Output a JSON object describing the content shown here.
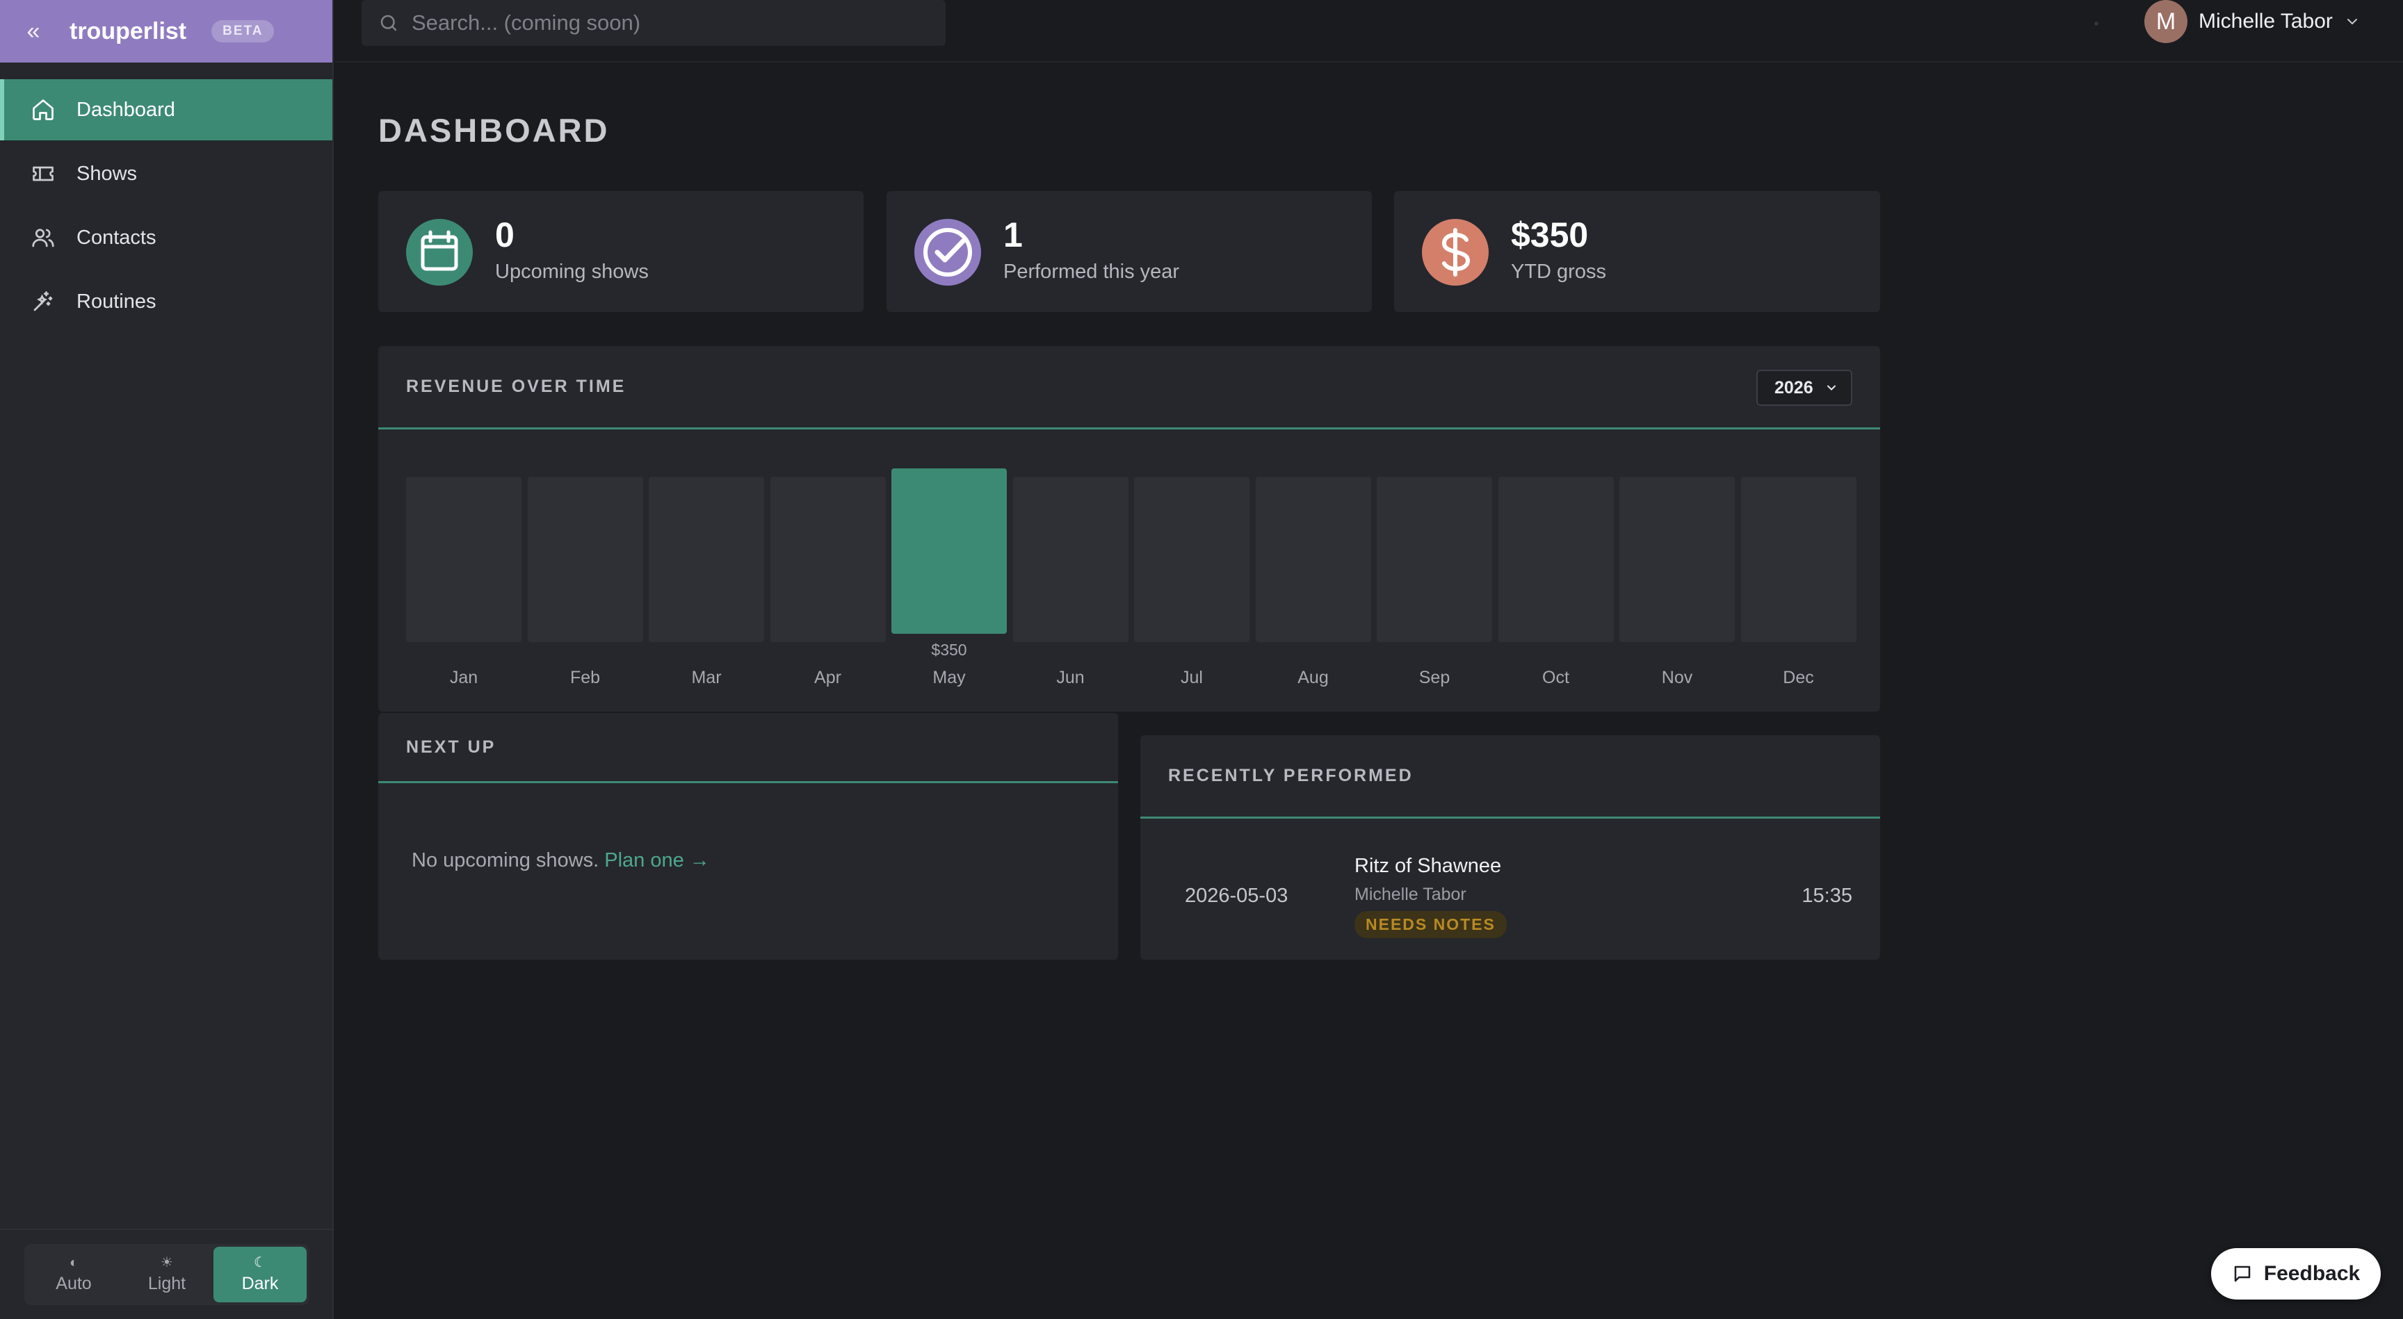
{
  "app": {
    "name": "trouperlist",
    "badge": "BETA",
    "collapse_icon": "«"
  },
  "sidebar": {
    "items": [
      {
        "label": "Dashboard",
        "icon": "home-icon",
        "active": true
      },
      {
        "label": "Shows",
        "icon": "ticket-icon",
        "active": false
      },
      {
        "label": "Contacts",
        "icon": "users-icon",
        "active": false
      },
      {
        "label": "Routines",
        "icon": "sparkle-wand-icon",
        "active": false
      }
    ],
    "theme": [
      {
        "label": "Auto",
        "icon": "◐",
        "active": false
      },
      {
        "label": "Light",
        "icon": "☀",
        "active": false
      },
      {
        "label": "Dark",
        "icon": "☾",
        "active": true
      }
    ]
  },
  "topbar": {
    "search_placeholder": "Search... (coming soon)",
    "user": {
      "initial": "M",
      "name": "Michelle Tabor"
    }
  },
  "page": {
    "title": "DASHBOARD"
  },
  "stats": [
    {
      "value": "0",
      "label": "Upcoming shows",
      "icon": "calendar-icon",
      "color": "#3d8a74"
    },
    {
      "value": "1",
      "label": "Performed this year",
      "icon": "check-circle-icon",
      "color": "#8f7cc0"
    },
    {
      "value": "$350",
      "label": "YTD gross",
      "icon": "dollar-icon",
      "color": "#d47f6a"
    }
  ],
  "revenue": {
    "title": "REVENUE OVER TIME",
    "year": "2026"
  },
  "chart_data": {
    "type": "bar",
    "categories": [
      "Jan",
      "Feb",
      "Mar",
      "Apr",
      "May",
      "Jun",
      "Jul",
      "Aug",
      "Sep",
      "Oct",
      "Nov",
      "Dec"
    ],
    "values": [
      0,
      0,
      0,
      0,
      350,
      0,
      0,
      0,
      0,
      0,
      0,
      0
    ],
    "value_labels": [
      "",
      "",
      "",
      "",
      "$350",
      "",
      "",
      "",
      "",
      "",
      "",
      ""
    ],
    "title": "REVENUE OVER TIME",
    "xlabel": "",
    "ylabel": "",
    "ylim": [
      0,
      350
    ],
    "grid": false,
    "colors": {
      "bar": "#3d8a74",
      "empty": "#2e3035"
    }
  },
  "next_up": {
    "title": "NEXT UP",
    "empty_text": "No upcoming shows.",
    "link_text": "Plan one →"
  },
  "recent": {
    "title": "RECENTLY PERFORMED",
    "rows": [
      {
        "date": "2026-05-03",
        "venue": "Ritz of Shawnee",
        "performer": "Michelle Tabor",
        "badge": "NEEDS NOTES",
        "time": "15:35"
      }
    ]
  },
  "feedback": {
    "label": "Feedback",
    "icon": "chat-bubble-icon"
  }
}
